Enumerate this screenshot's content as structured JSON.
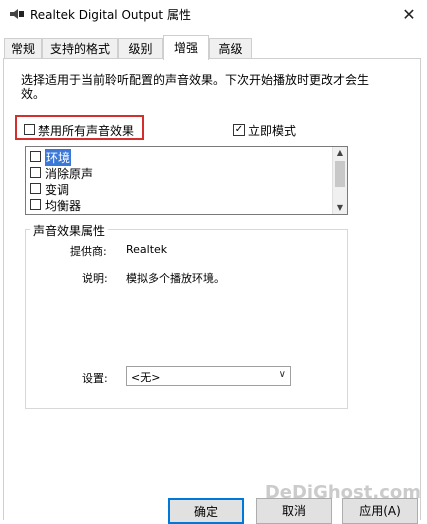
{
  "window": {
    "title": "Realtek Digital Output 属性",
    "close_glyph": "✕"
  },
  "tabs": [
    {
      "label": "常规"
    },
    {
      "label": "支持的格式"
    },
    {
      "label": "级别"
    },
    {
      "label": "增强"
    },
    {
      "label": "高级"
    }
  ],
  "enhancements": {
    "intro": "选择适用于当前聆听配置的声音效果。下次开始播放时更改才会生效。",
    "disable_all_label": "禁用所有声音效果",
    "disable_all_checked": false,
    "immediate_label": "立即模式",
    "immediate_checked": true,
    "effects": [
      {
        "label": "环境",
        "checked": false,
        "selected": true
      },
      {
        "label": "消除原声",
        "checked": false
      },
      {
        "label": "变调",
        "checked": false
      },
      {
        "label": "均衡器",
        "checked": false
      }
    ]
  },
  "properties": {
    "group_title": "声音效果属性",
    "provider_label": "提供商:",
    "provider_value": "Realtek",
    "desc_label": "说明:",
    "desc_value": "模拟多个播放环境。",
    "settings_label": "设置:",
    "settings_value": "<无>"
  },
  "buttons": {
    "ok": "确定",
    "cancel": "取消",
    "apply": "应用(A)"
  },
  "watermark": "DeDiGhost.com",
  "colors": {
    "highlight": "#d32f2f",
    "selection": "#3b79d9",
    "focus": "#0078d7"
  }
}
